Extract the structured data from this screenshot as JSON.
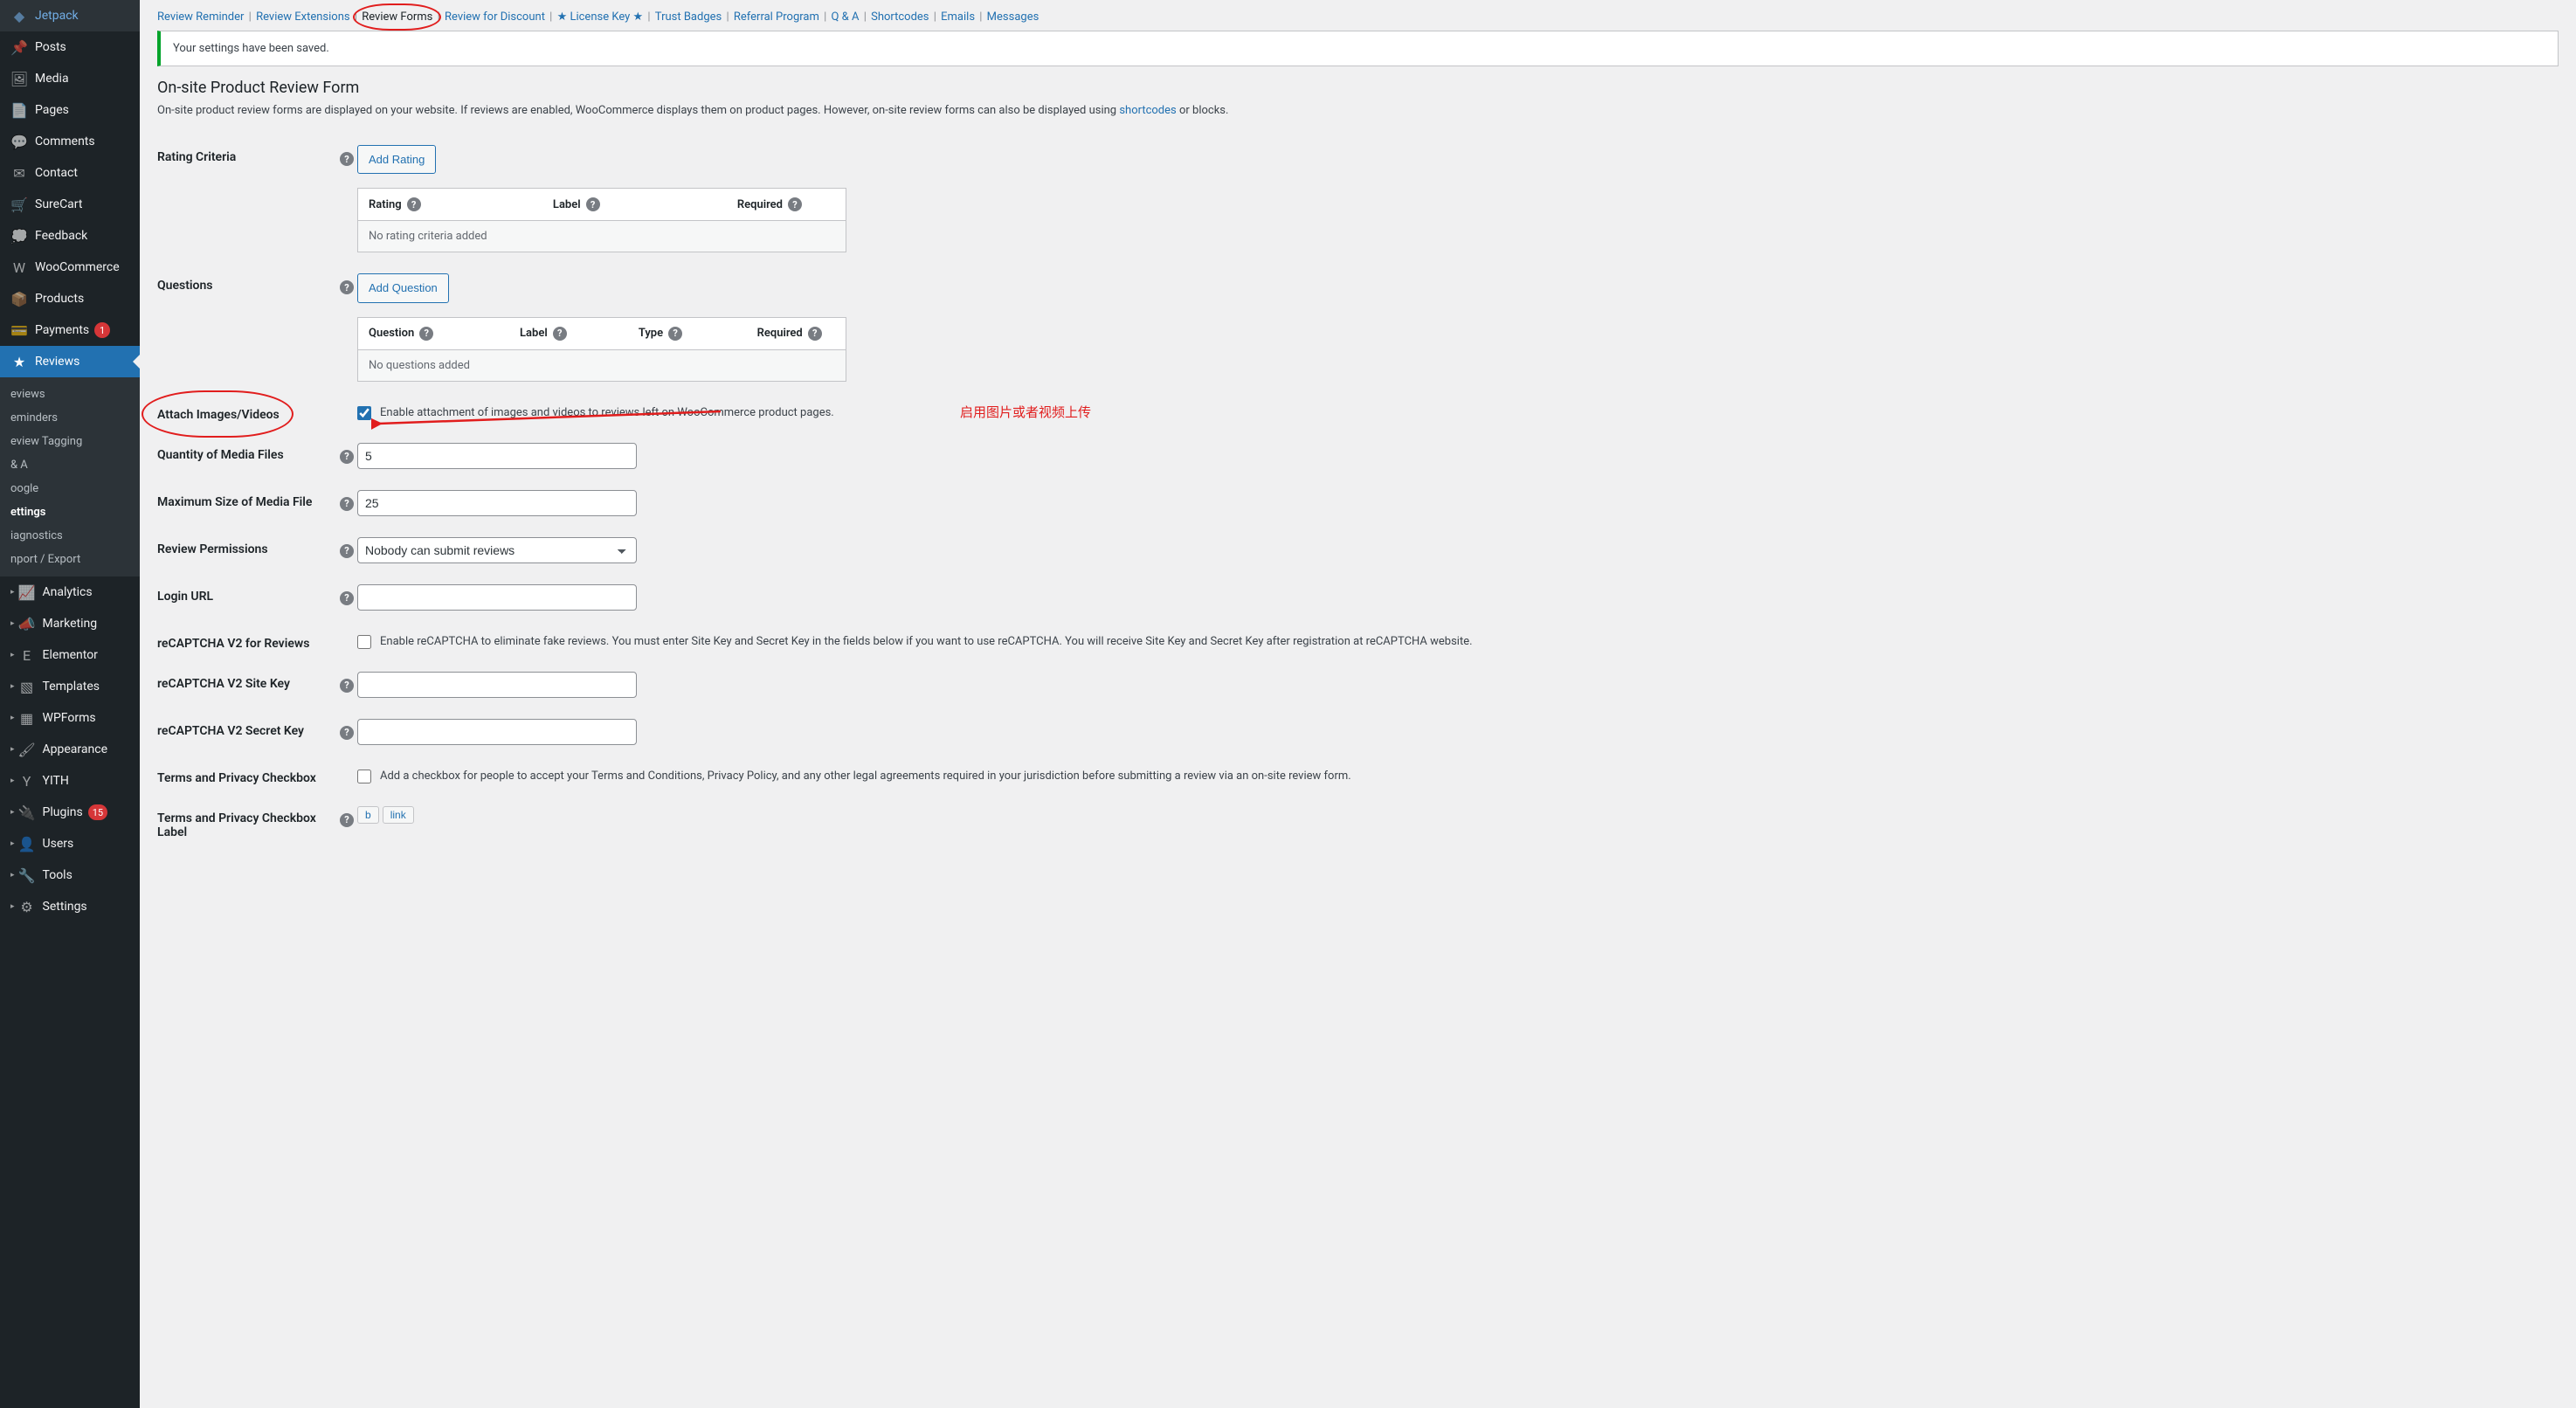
{
  "sidebar": {
    "items": [
      {
        "label": "Jetpack",
        "icon": "◆"
      },
      {
        "label": "Posts",
        "icon": "📌"
      },
      {
        "label": "Media",
        "icon": "🖼"
      },
      {
        "label": "Pages",
        "icon": "📄"
      },
      {
        "label": "Comments",
        "icon": "💬"
      },
      {
        "label": "Contact",
        "icon": "✉"
      },
      {
        "label": "SureCart",
        "icon": "🛒"
      },
      {
        "label": "Feedback",
        "icon": "💭"
      },
      {
        "label": "WooCommerce",
        "icon": "W"
      },
      {
        "label": "Products",
        "icon": "📦"
      },
      {
        "label": "Payments",
        "icon": "💳",
        "badge": "1"
      },
      {
        "label": "Reviews",
        "icon": "★",
        "active": true
      },
      {
        "label": "Analytics",
        "icon": "📈"
      },
      {
        "label": "Marketing",
        "icon": "📣"
      },
      {
        "label": "Elementor",
        "icon": "E"
      },
      {
        "label": "Templates",
        "icon": "▧"
      },
      {
        "label": "WPForms",
        "icon": "▦"
      },
      {
        "label": "Appearance",
        "icon": "🖌"
      },
      {
        "label": "YITH",
        "icon": "Y"
      },
      {
        "label": "Plugins",
        "icon": "🔌",
        "badge": "15"
      },
      {
        "label": "Users",
        "icon": "👤"
      },
      {
        "label": "Tools",
        "icon": "🔧"
      },
      {
        "label": "Settings",
        "icon": "⚙"
      }
    ],
    "submenu": [
      {
        "label": "eviews"
      },
      {
        "label": "eminders"
      },
      {
        "label": "eview Tagging"
      },
      {
        "label": "& A"
      },
      {
        "label": "oogle"
      },
      {
        "label": "ettings",
        "current": true
      },
      {
        "label": "iagnostics"
      },
      {
        "label": "nport / Export"
      }
    ]
  },
  "tabs": [
    {
      "label": "Review Reminder"
    },
    {
      "label": "Review Extensions"
    },
    {
      "label": "Review Forms",
      "active": true,
      "circled": true
    },
    {
      "label": "Review for Discount"
    },
    {
      "label": "★ License Key ★"
    },
    {
      "label": "Trust Badges"
    },
    {
      "label": "Referral Program"
    },
    {
      "label": "Q & A"
    },
    {
      "label": "Shortcodes"
    },
    {
      "label": "Emails"
    },
    {
      "label": "Messages"
    }
  ],
  "notice": "Your settings have been saved.",
  "section": {
    "title": "On-site Product Review Form",
    "desc_pre": "On-site product review forms are displayed on your website. If reviews are enabled, WooCommerce displays them on product pages. However, on-site review forms can also be displayed using ",
    "desc_link": "shortcodes",
    "desc_post": " or blocks."
  },
  "fields": {
    "rating_criteria": {
      "label": "Rating Criteria",
      "button": "Add Rating",
      "head": [
        "Rating",
        "Label",
        "Required"
      ],
      "empty": "No rating criteria added"
    },
    "questions": {
      "label": "Questions",
      "button": "Add Question",
      "head": [
        "Question",
        "Label",
        "Type",
        "Required"
      ],
      "empty": "No questions added"
    },
    "attach": {
      "label": "Attach Images/Videos",
      "check_label": "Enable attachment of images and videos to reviews left on WooCommerce product pages.",
      "checked": true,
      "annotation": "启用图片或者视频上传"
    },
    "quantity": {
      "label": "Quantity of Media Files",
      "value": "5"
    },
    "maxsize": {
      "label": "Maximum Size of Media File",
      "value": "25"
    },
    "permissions": {
      "label": "Review Permissions",
      "value": "Nobody can submit reviews"
    },
    "login_url": {
      "label": "Login URL",
      "value": ""
    },
    "recaptcha": {
      "label": "reCAPTCHA V2 for Reviews",
      "check_label": "Enable reCAPTCHA to eliminate fake reviews. You must enter Site Key and Secret Key in the fields below if you want to use reCAPTCHA. You will receive Site Key and Secret Key after registration at reCAPTCHA website.",
      "checked": false
    },
    "sitekey": {
      "label": "reCAPTCHA V2 Site Key",
      "value": ""
    },
    "secretkey": {
      "label": "reCAPTCHA V2 Secret Key",
      "value": ""
    },
    "terms": {
      "label": "Terms and Privacy Checkbox",
      "check_label": "Add a checkbox for people to accept your Terms and Conditions, Privacy Policy, and any other legal agreements required in your jurisdiction before submitting a review via an on-site review form.",
      "checked": false
    },
    "terms_label": {
      "label": "Terms and Privacy Checkbox Label",
      "qt": [
        "b",
        "link"
      ]
    }
  }
}
